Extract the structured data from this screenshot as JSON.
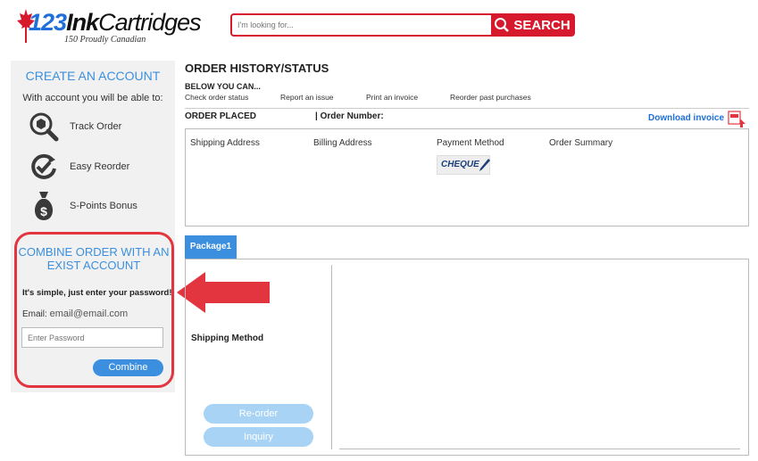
{
  "header": {
    "logo": {
      "n123": "123",
      "ink": "Ink",
      "cart": "Cartridges",
      "tagline": "150 Proudly Canadian"
    },
    "search": {
      "placeholder": "I'm looking for...",
      "button_label": "SEARCH",
      "icon": "search-icon"
    }
  },
  "sidebar": {
    "create_title": "CREATE AN ACCOUNT",
    "create_sub": "With account you will be able to:",
    "features": [
      {
        "label": "Track Order",
        "icon": "track-order-icon"
      },
      {
        "label": "Easy Reorder",
        "icon": "reorder-icon"
      },
      {
        "label": "S-Points Bonus",
        "icon": "money-bag-icon"
      }
    ],
    "combine_title": "COMBINE ORDER WITH AN EXIST ACCOUNT",
    "simple_text": "It's simple, just enter your password!",
    "email_label": "Email:",
    "email_value": "email@email.com",
    "password_placeholder": "Enter Password",
    "combine_button": "Combine"
  },
  "main": {
    "title": "ORDER HISTORY/STATUS",
    "below": "BELOW YOU CAN...",
    "actions": [
      "Check order status",
      "Report an issue",
      "Print an invoice",
      "Reorder past purchases"
    ],
    "order_placed": "ORDER PLACED",
    "order_number": "| Order Number:",
    "download_invoice": "Download invoice",
    "columns": [
      "Shipping Address",
      "Billing Address",
      "Payment Method",
      "Order Summary"
    ],
    "payment_badge": "CHEQUE",
    "package_tab": "Package1",
    "shipping_method": "Shipping Method",
    "reorder_button": "Re-order",
    "inquiry_button": "Inquiry"
  },
  "colors": {
    "accent_red": "#d7192d",
    "accent_blue": "#3b8fde",
    "light_blue": "#a8d3f5"
  }
}
